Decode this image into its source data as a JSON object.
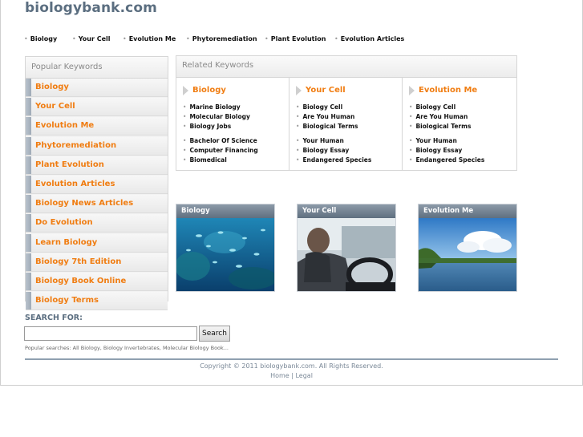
{
  "site": {
    "title": "biologybank.com"
  },
  "topnav": [
    "Biology",
    "Your Cell",
    "Evolution Me",
    "Phytoremediation",
    "Plant Evolution",
    "Evolution Articles"
  ],
  "popular": {
    "heading": "Popular Keywords",
    "items": [
      "Biology",
      "Your Cell",
      "Evolution Me",
      "Phytoremediation",
      "Plant Evolution",
      "Evolution Articles",
      "Biology News Articles",
      "Do Evolution",
      "Learn Biology",
      "Biology 7th Edition",
      "Biology Book Online",
      "Biology Terms"
    ]
  },
  "related": {
    "heading": "Related Keywords",
    "columns": [
      {
        "title": "Biology",
        "group1": [
          "Marine Biology",
          "Molecular Biology",
          "Biology Jobs"
        ],
        "group2": [
          "Bachelor Of Science",
          "Computer Financing",
          "Biomedical"
        ]
      },
      {
        "title": "Your Cell",
        "group1": [
          "Biology Cell",
          "Are You Human",
          "Biological Terms"
        ],
        "group2": [
          "Your Human",
          "Biology Essay",
          "Endangered Species"
        ]
      },
      {
        "title": "Evolution Me",
        "group1": [
          "Biology Cell",
          "Are You Human",
          "Biological Terms"
        ],
        "group2": [
          "Your Human",
          "Biology Essay",
          "Endangered Species"
        ]
      }
    ]
  },
  "cards": [
    {
      "title": "Biology"
    },
    {
      "title": "Your Cell"
    },
    {
      "title": "Evolution Me"
    }
  ],
  "search": {
    "label": "SEARCH FOR:",
    "value": "",
    "button": "Search",
    "popular": "Popular searches: All Biology, Biology Invertebrates, Molecular Biology Book..."
  },
  "footer": {
    "copyright": "Copyright © 2011 biologybank.com. All Rights Reserved.",
    "home": "Home",
    "separator": "|",
    "legal": "Legal"
  },
  "colors": {
    "accent": "#f07d12",
    "title": "#5b6e80",
    "card_header": "#6f7f90"
  }
}
